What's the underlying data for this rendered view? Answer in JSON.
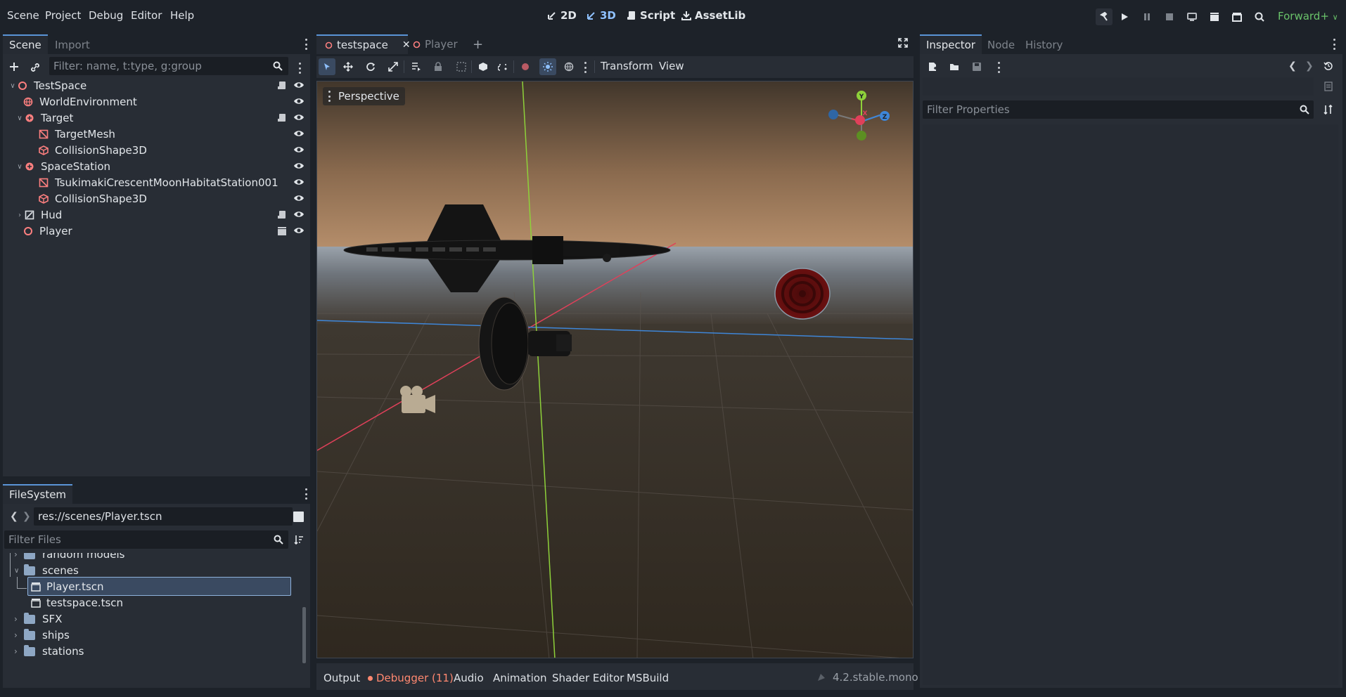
{
  "menu": [
    "Scene",
    "Project",
    "Debug",
    "Editor",
    "Help"
  ],
  "modes": [
    {
      "label": "2D",
      "icon": "2d-icon"
    },
    {
      "label": "3D",
      "icon": "3d-icon"
    },
    {
      "label": "Script",
      "icon": "script-icon"
    },
    {
      "label": "AssetLib",
      "icon": "assetlib-icon"
    }
  ],
  "renderer": "Forward+",
  "scene_panel": {
    "tabs": [
      "Scene",
      "Import"
    ],
    "filter_placeholder": "Filter: name, t:type, g:group",
    "nodes": [
      {
        "name": "TestSpace",
        "icon": "node3d-icon",
        "color": "#fc7f7f"
      },
      {
        "name": "WorldEnvironment",
        "icon": "world-environment-icon",
        "color": "#fc7f7f"
      },
      {
        "name": "Target",
        "icon": "static-body-icon",
        "color": "#fc7f7f"
      },
      {
        "name": "TargetMesh",
        "icon": "mesh-instance-icon",
        "color": "#fc7f7f"
      },
      {
        "name": "CollisionShape3D",
        "icon": "collision-shape-icon",
        "color": "#fc7f7f"
      },
      {
        "name": "SpaceStation",
        "icon": "static-body-icon",
        "color": "#fc7f7f"
      },
      {
        "name": "TsukimakiCrescentMoonHabitatStation001",
        "icon": "mesh-instance-icon",
        "color": "#fc7f7f"
      },
      {
        "name": "CollisionShape3D",
        "icon": "collision-shape-icon",
        "color": "#fc7f7f"
      },
      {
        "name": "Hud",
        "icon": "control-icon",
        "color": "#dde1e6"
      },
      {
        "name": "Player",
        "icon": "node3d-icon",
        "color": "#fc7f7f"
      }
    ]
  },
  "filesystem": {
    "tab": "FileSystem",
    "path": "res://scenes/Player.tscn",
    "filter_placeholder": "Filter Files",
    "items": [
      {
        "name": "random models",
        "type": "folder"
      },
      {
        "name": "scenes",
        "type": "folder"
      },
      {
        "name": "Player.tscn",
        "type": "scene",
        "selected": true
      },
      {
        "name": "testspace.tscn",
        "type": "scene"
      },
      {
        "name": "SFX",
        "type": "folder"
      },
      {
        "name": "ships",
        "type": "folder"
      },
      {
        "name": "stations",
        "type": "folder"
      }
    ]
  },
  "editor_tabs": [
    "testspace",
    "Player"
  ],
  "viewport_toolbar": {
    "transform": "Transform",
    "view": "View"
  },
  "viewport": {
    "perspective_label": "Perspective",
    "gizmo": {
      "y": "Y",
      "x": "X",
      "z": "Z"
    }
  },
  "bottom_tabs": [
    "Output",
    "Debugger (11)",
    "Audio",
    "Animation",
    "Shader Editor",
    "MSBuild"
  ],
  "version": "4.2.stable.mono",
  "inspector": {
    "tabs": [
      "Inspector",
      "Node",
      "History"
    ],
    "filter_placeholder": "Filter Properties"
  },
  "colors": {
    "accent": "#5a94d6",
    "node_red": "#fc7f7f",
    "debugger": "#ff8870",
    "renderer": "#6ac36a"
  }
}
